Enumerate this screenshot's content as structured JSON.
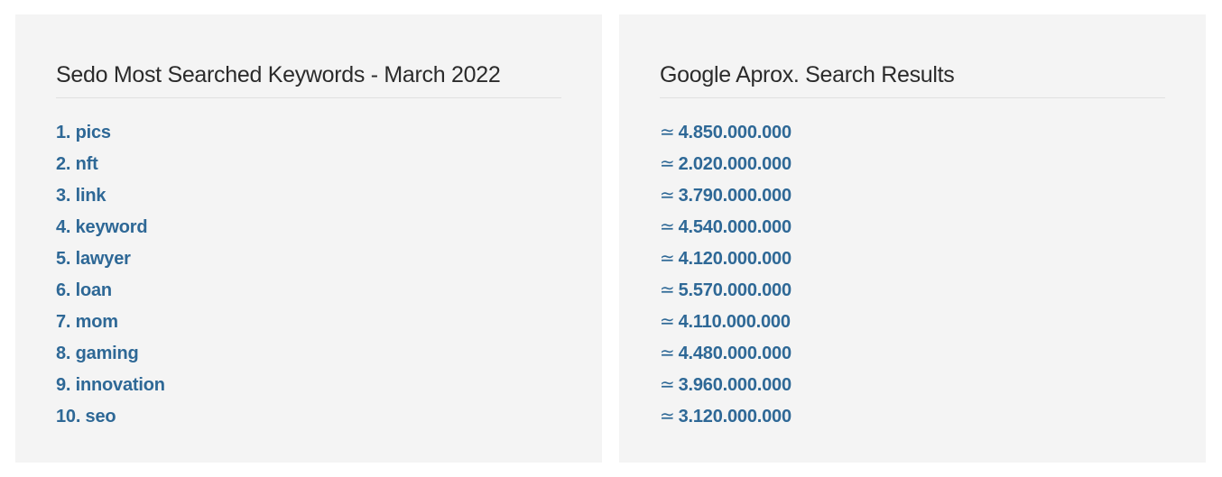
{
  "keywords_panel": {
    "title": "Sedo Most Searched Keywords - March 2022",
    "items": [
      "1. pics",
      "2. nft",
      "3. link",
      "4. keyword",
      "5. lawyer",
      "6. loan",
      "7. mom",
      "8. gaming",
      "9. innovation",
      "10. seo"
    ]
  },
  "results_panel": {
    "title": "Google Aprox. Search Results",
    "approx_symbol": "≃",
    "items": [
      "4.850.000.000",
      "2.020.000.000",
      "3.790.000.000",
      "4.540.000.000",
      "4.120.000.000",
      "5.570.000.000",
      "4.110.000.000",
      "4.480.000.000",
      "3.960.000.000",
      "3.120.000.000"
    ]
  },
  "colors": {
    "panel_background": "#f4f4f4",
    "title_text": "#2b2b2b",
    "link_text": "#2e6896"
  }
}
